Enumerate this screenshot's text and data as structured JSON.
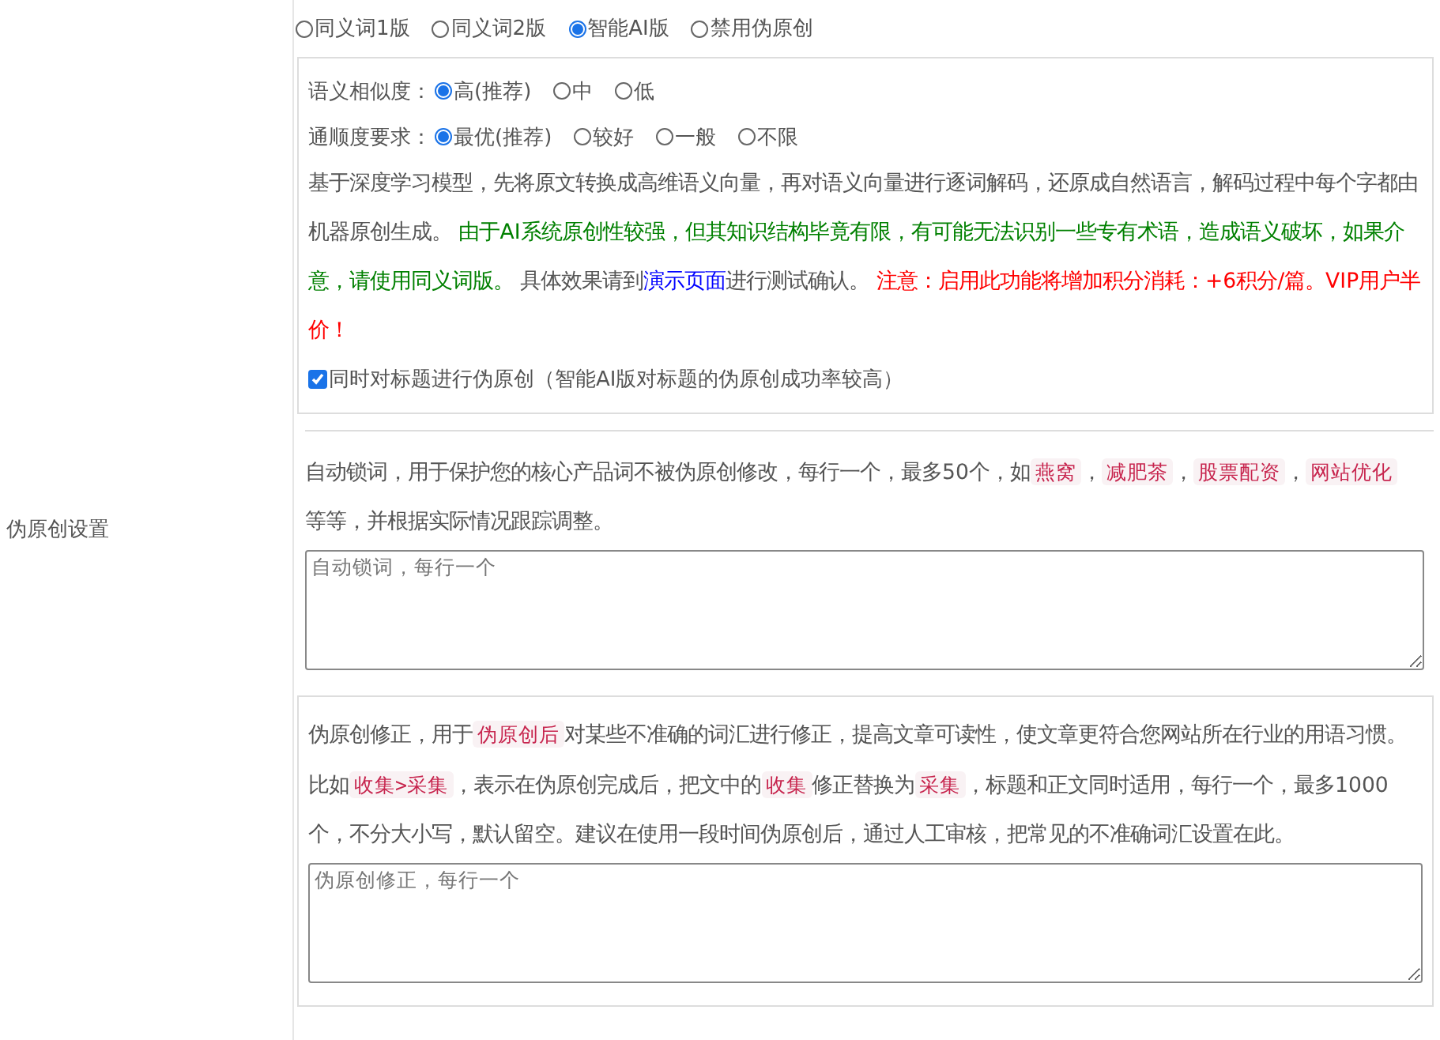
{
  "row_label": "伪原创设置",
  "modes": [
    {
      "label": "同义词1版",
      "selected": false
    },
    {
      "label": "同义词2版",
      "selected": false
    },
    {
      "label": "智能AI版",
      "selected": true
    },
    {
      "label": "禁用伪原创",
      "selected": false
    }
  ],
  "ai_options": {
    "groups": [
      {
        "label": "语义相似度：",
        "options": [
          {
            "label": "高(推荐)",
            "selected": true
          },
          {
            "label": "中",
            "selected": false
          },
          {
            "label": "低",
            "selected": false
          }
        ]
      },
      {
        "label": "通顺度要求：",
        "options": [
          {
            "label": "最优(推荐)",
            "selected": true
          },
          {
            "label": "较好",
            "selected": false
          },
          {
            "label": "一般",
            "selected": false
          },
          {
            "label": "不限",
            "selected": false
          }
        ]
      }
    ],
    "description": [
      {
        "kind": "text",
        "text": "基于深度学习模型，先将原文转换成高维语义向量，再对语义向量进行逐词解码，还原成自然语言，解码过程中每个字都由机器原创生成。 "
      },
      {
        "kind": "green",
        "text": "由于AI系统原创性较强，但其知识结构毕竟有限，有可能无法识别一些专有术语，造成语义破坏，如果介意，请使用同义词版。"
      },
      {
        "kind": "text",
        "text": " 具体效果请到"
      },
      {
        "kind": "link",
        "text": "演示页面"
      },
      {
        "kind": "text",
        "text": "进行测试确认。 "
      },
      {
        "kind": "red",
        "text": "注意：启用此功能将增加积分消耗：+6积分/篇。VIP用户半价！"
      }
    ],
    "title_option": {
      "label": "同时对标题进行伪原创（智能AI版对标题的伪原创成功率较高）",
      "checked": true
    }
  },
  "lock_words": {
    "description": [
      {
        "kind": "text",
        "text": "自动锁词，用于保护您的核心产品词不被伪原创修改，每行一个，最多50个，如"
      },
      {
        "kind": "tag",
        "text": "燕窝"
      },
      {
        "kind": "text",
        "text": "，"
      },
      {
        "kind": "tag",
        "text": "减肥茶"
      },
      {
        "kind": "text",
        "text": "，"
      },
      {
        "kind": "tag",
        "text": "股票配资"
      },
      {
        "kind": "text",
        "text": "，"
      },
      {
        "kind": "tag",
        "text": "网站优化"
      },
      {
        "kind": "text",
        "text": " 等等，并根据实际情况跟踪调整。"
      }
    ],
    "field": {
      "placeholder": "自动锁词，每行一个"
    }
  },
  "corrections": {
    "description": [
      {
        "kind": "text",
        "text": "伪原创修正，用于"
      },
      {
        "kind": "tag",
        "text": "伪原创后"
      },
      {
        "kind": "text",
        "text": "对某些不准确的词汇进行修正，提高文章可读性，使文章更符合您网站所在行业的用语习惯。比如"
      },
      {
        "kind": "tag",
        "text": "收集>采集"
      },
      {
        "kind": "text",
        "text": "，表示在伪原创完成后，把文中的"
      },
      {
        "kind": "tag",
        "text": "收集"
      },
      {
        "kind": "text",
        "text": "修正替换为"
      },
      {
        "kind": "tag",
        "text": "采集"
      },
      {
        "kind": "text",
        "text": "，标题和正文同时适用，每行一个，最多1000个，不分大小写，默认留空。建议在使用一段时间伪原创后，通过人工审核，把常见的不准确词汇设置在此。"
      }
    ],
    "field": {
      "placeholder": "伪原创修正，每行一个"
    }
  }
}
